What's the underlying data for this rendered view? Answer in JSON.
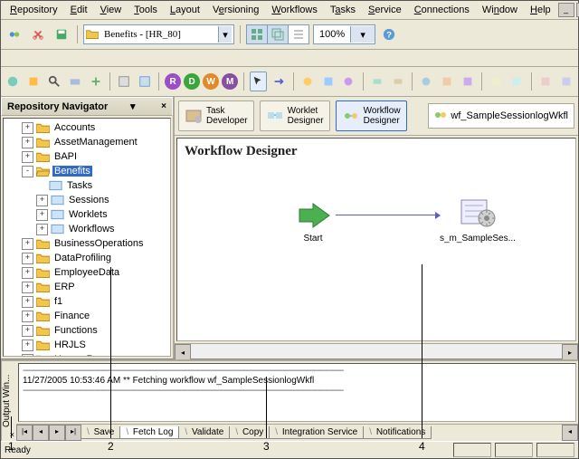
{
  "menu": {
    "items": [
      {
        "key": "R",
        "label": "Repository"
      },
      {
        "key": "E",
        "label": "Edit"
      },
      {
        "key": "V",
        "label": "View"
      },
      {
        "key": "T",
        "label": "Tools"
      },
      {
        "key": "L",
        "label": "Layout"
      },
      {
        "key": "e",
        "label": "Versioning"
      },
      {
        "key": "W",
        "label": "Workflows"
      },
      {
        "key": "a",
        "label": "Tasks"
      },
      {
        "key": "S",
        "label": "Service"
      },
      {
        "key": "C",
        "label": "Connections"
      },
      {
        "key": "n",
        "label": "Window"
      },
      {
        "key": "H",
        "label": "Help"
      }
    ]
  },
  "folderCombo": {
    "value": "Benefits - [HR_80]"
  },
  "zoom": {
    "value": "100%"
  },
  "orbs": [
    {
      "bg": "#9b4fc4",
      "t": "R"
    },
    {
      "bg": "#3aa63a",
      "t": "D"
    },
    {
      "bg": "#e08a2a",
      "t": "W"
    },
    {
      "bg": "#884ea0",
      "t": "M"
    }
  ],
  "navTitle": "Repository Navigator",
  "tree": [
    {
      "indent": 1,
      "exp": "+",
      "icon": "folder",
      "label": "Accounts"
    },
    {
      "indent": 1,
      "exp": "+",
      "icon": "folder",
      "label": "AssetManagement"
    },
    {
      "indent": 1,
      "exp": "+",
      "icon": "folder",
      "label": "BAPI"
    },
    {
      "indent": 1,
      "exp": "-",
      "icon": "folder-open",
      "label": "Benefits",
      "sel": true
    },
    {
      "indent": 2,
      "exp": " ",
      "icon": "sub",
      "label": "Tasks"
    },
    {
      "indent": 2,
      "exp": "+",
      "icon": "sub",
      "label": "Sessions"
    },
    {
      "indent": 2,
      "exp": "+",
      "icon": "sub",
      "label": "Worklets"
    },
    {
      "indent": 2,
      "exp": "+",
      "icon": "sub",
      "label": "Workflows"
    },
    {
      "indent": 1,
      "exp": "+",
      "icon": "folder",
      "label": "BusinessOperations"
    },
    {
      "indent": 1,
      "exp": "+",
      "icon": "folder",
      "label": "DataProfiling"
    },
    {
      "indent": 1,
      "exp": "+",
      "icon": "folder",
      "label": "EmployeeData"
    },
    {
      "indent": 1,
      "exp": "+",
      "icon": "folder",
      "label": "ERP"
    },
    {
      "indent": 1,
      "exp": "+",
      "icon": "folder",
      "label": "f1"
    },
    {
      "indent": 1,
      "exp": "+",
      "icon": "folder",
      "label": "Finance"
    },
    {
      "indent": 1,
      "exp": "+",
      "icon": "folder",
      "label": "Functions"
    },
    {
      "indent": 1,
      "exp": "+",
      "icon": "folder",
      "label": "HRJLS"
    },
    {
      "indent": 1,
      "exp": "+",
      "icon": "folder",
      "label": "HumanResources"
    }
  ],
  "modes": {
    "task": {
      "l1": "Task",
      "l2": "Developer"
    },
    "worklet": {
      "l1": "Worklet",
      "l2": "Designer"
    },
    "workflow": {
      "l1": "Workflow",
      "l2": "Designer"
    }
  },
  "wfLabel": "wf_SampleSessionlogWkfl",
  "canvas": {
    "title": "Workflow Designer",
    "start": "Start",
    "session": "s_m_SampleSes..."
  },
  "output": {
    "title": "Output Win...",
    "log": "11/27/2005 10:53:46 AM ** Fetching workflow wf_SampleSessionlogWkfl",
    "tabs": [
      "Save",
      "Fetch Log",
      "Validate",
      "Copy",
      "Integration Service",
      "Notifications"
    ],
    "activeTab": 1
  },
  "status": {
    "ready": "Ready"
  },
  "callouts": [
    "1",
    "2",
    "3",
    "4"
  ]
}
